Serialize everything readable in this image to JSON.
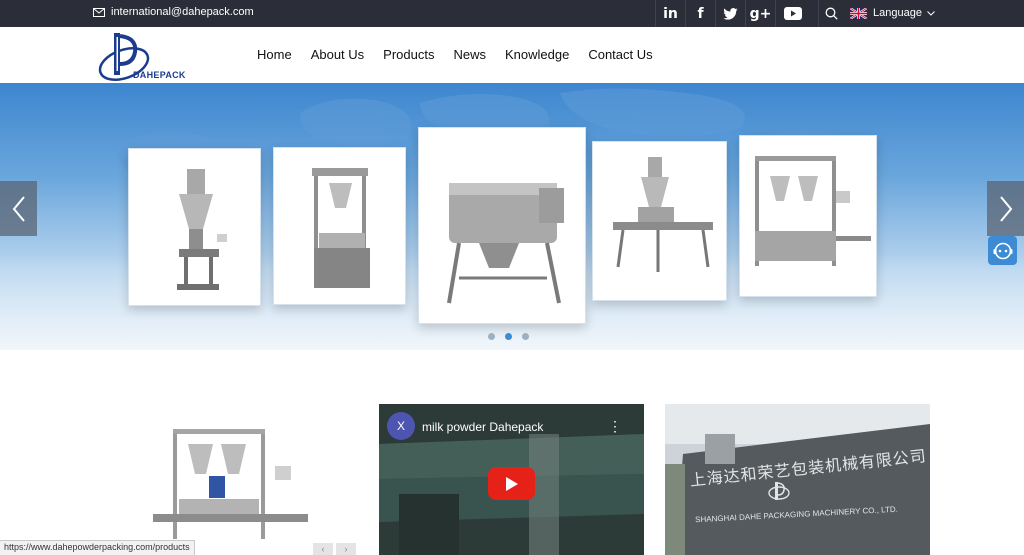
{
  "topbar": {
    "email": "international@dahepack.com",
    "socials": [
      {
        "icon": "linkedin-icon",
        "glyph": "in"
      },
      {
        "icon": "facebook-icon",
        "glyph": "f"
      },
      {
        "icon": "twitter-icon",
        "glyph": "t"
      },
      {
        "icon": "google-plus-icon",
        "glyph": "g+"
      },
      {
        "icon": "youtube-icon",
        "glyph": "▶"
      }
    ],
    "language_label": "Language"
  },
  "header": {
    "logo_text": "DAHEPACK",
    "nav": [
      "Home",
      "About Us",
      "Products",
      "News",
      "Knowledge",
      "Contact Us"
    ]
  },
  "banner": {
    "slide_count": 3,
    "active_slide": 2
  },
  "video": {
    "avatar_letter": "X",
    "title": "milk powder Dahepack"
  },
  "company_sign": {
    "chinese": "上海达和荣艺包装机械有限公司",
    "english": "SHANGHAI DAHE PACKAGING MACHINERY CO., LTD."
  },
  "status_url": "https://www.dahepowderpacking.com/products",
  "colors": {
    "topbar_bg": "#2b2e38",
    "accent_blue": "#3d8bd5",
    "youtube_red": "#e62117"
  }
}
